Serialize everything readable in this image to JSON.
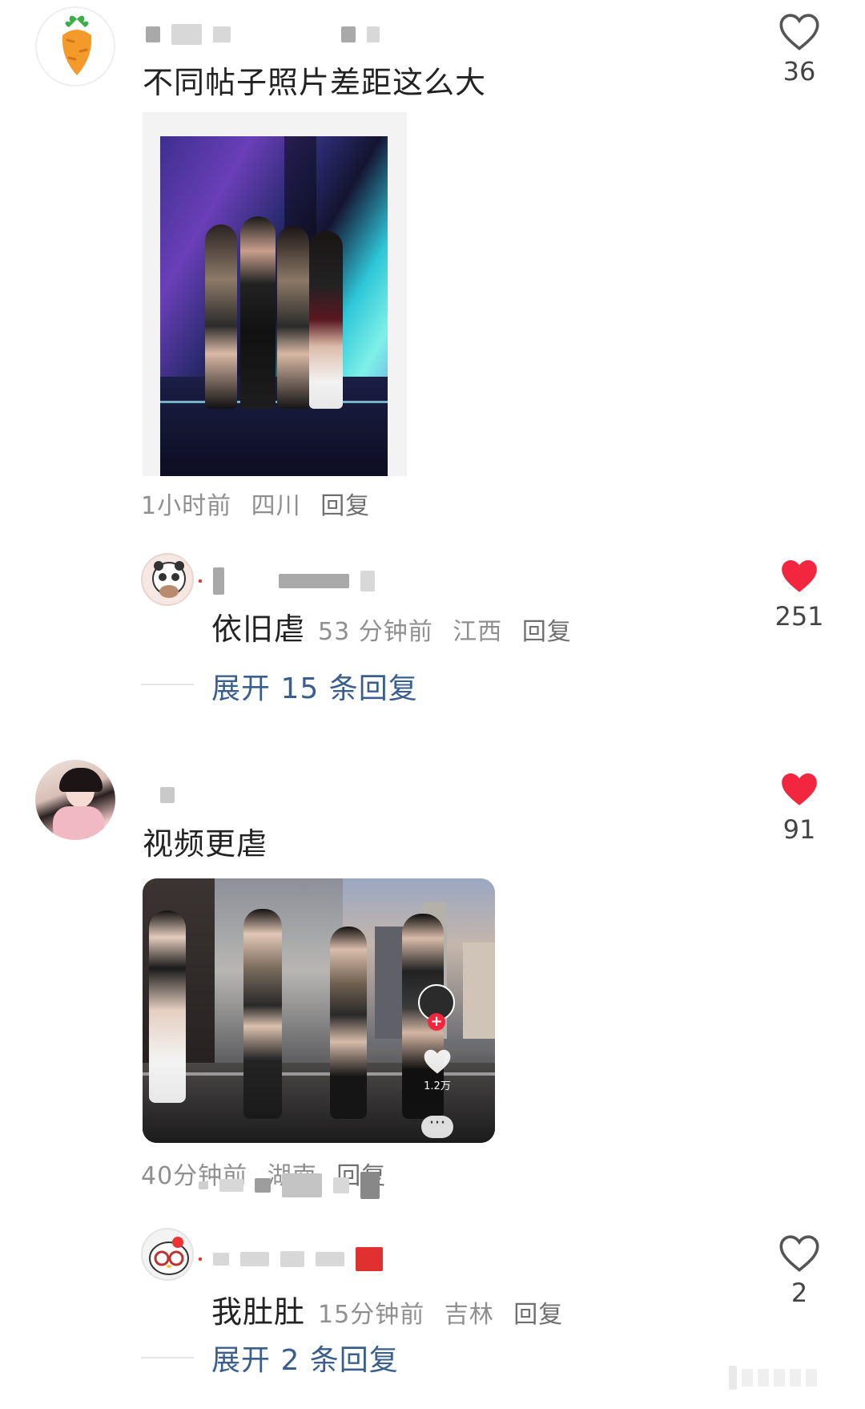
{
  "comments": [
    {
      "text": "不同帖子照片差距这么大",
      "likes": "36",
      "liked": false,
      "meta": {
        "time": "1小时前",
        "location": "四川",
        "reply": "回复"
      },
      "replies": [
        {
          "text": "依旧虐",
          "likes": "251",
          "liked": true,
          "meta": {
            "time": "53 分钟前",
            "location": "江西",
            "reply": "回复"
          }
        }
      ],
      "expand": "展开 15 条回复"
    },
    {
      "text": "视频更虐",
      "likes": "91",
      "liked": true,
      "meta": {
        "time": "40分钟前",
        "location": "湖南",
        "reply": "回复"
      },
      "video_overlay": {
        "likes": "1.2万"
      },
      "replies": [
        {
          "text": "我肚肚",
          "likes": "2",
          "liked": false,
          "meta": {
            "time": "15分钟前",
            "location": "吉林",
            "reply": "回复"
          }
        }
      ],
      "expand": "展开 2 条回复"
    }
  ],
  "colors": {
    "heart_red": "#f2273f",
    "link_blue": "#3a5f8e",
    "meta_gray": "#8f8f8f"
  },
  "icons": [
    "carrot-avatar-icon",
    "heart-outline-icon",
    "heart-filled-icon",
    "plus-icon",
    "more-icon"
  ]
}
